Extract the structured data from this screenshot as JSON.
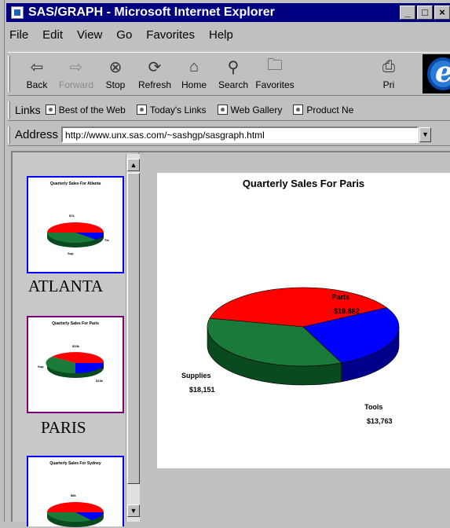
{
  "window": {
    "title": "SAS/GRAPH - Microsoft Internet Explorer"
  },
  "menu": [
    "File",
    "Edit",
    "View",
    "Go",
    "Favorites",
    "Help"
  ],
  "toolbar": {
    "back": "Back",
    "forward": "Forward",
    "stop": "Stop",
    "refresh": "Refresh",
    "home": "Home",
    "search": "Search",
    "favorites": "Favorites",
    "print": "Pri"
  },
  "links": {
    "label": "Links",
    "items": [
      "Best of the Web",
      "Today's Links",
      "Web Gallery",
      "Product Ne"
    ]
  },
  "address": {
    "label": "Address",
    "url": "http://www.unx.sas.com/~sashgp/sasgraph.html"
  },
  "thumbnails": [
    {
      "title": "Quarterly Sales For Atlanta",
      "label": "ATLANTA"
    },
    {
      "title": "Quarterly Sales For Paris",
      "label": "PARIS"
    },
    {
      "title": "Quarterly Sales For Sydney",
      "label": ""
    }
  ],
  "chart_data": {
    "type": "pie",
    "title": "Quarterly Sales For Paris",
    "slices": [
      {
        "name": "Parts",
        "value": "$19,882",
        "color": "#ff0000"
      },
      {
        "name": "Tools",
        "value": "$13,763",
        "color": "#0000ff"
      },
      {
        "name": "Supplies",
        "value": "$18,151",
        "color": "#1a7a3a"
      }
    ]
  }
}
